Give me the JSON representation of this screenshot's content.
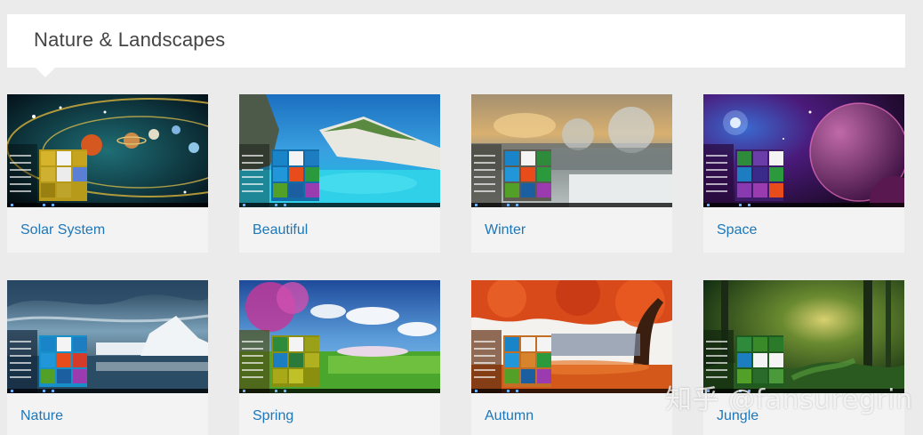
{
  "header": {
    "title": "Nature & Landscapes"
  },
  "cards": [
    {
      "label": "Solar System",
      "menu_color": "#b89a1a",
      "bg": "#0e2a36"
    },
    {
      "label": "Beautiful",
      "menu_color": "#136ba8",
      "bg": "#1b7fc2"
    },
    {
      "label": "Winter",
      "menu_color": "#5d5a52",
      "bg": "#7e8481"
    },
    {
      "label": "Space",
      "menu_color": "#3d1c6a",
      "bg": "#3a1860"
    },
    {
      "label": "Nature",
      "menu_color": "#1790c9",
      "bg": "#385a76"
    },
    {
      "label": "Spring",
      "menu_color": "#8a8f10",
      "bg": "#4f7f3f"
    },
    {
      "label": "Autumn",
      "menu_color": "#c26e24",
      "bg": "#c9602c"
    },
    {
      "label": "Jungle",
      "menu_color": "#1f5a1e",
      "bg": "#234f1e"
    }
  ],
  "watermark": "知乎 @fansuregrin"
}
